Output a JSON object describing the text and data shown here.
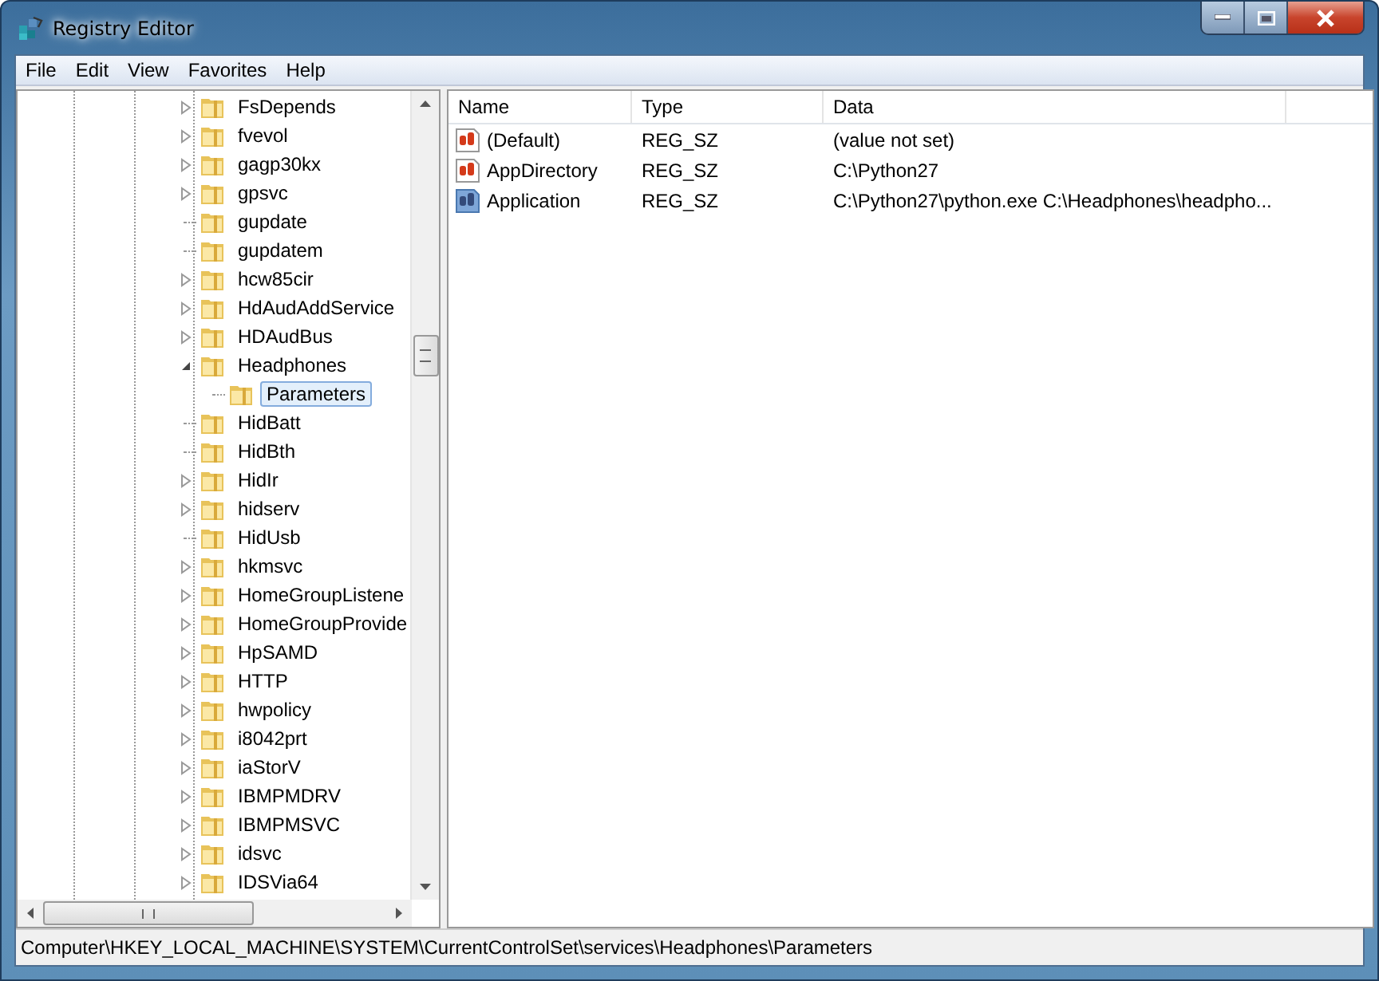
{
  "window": {
    "title": "Registry Editor"
  },
  "menu": [
    "File",
    "Edit",
    "View",
    "Favorites",
    "Help"
  ],
  "tree": [
    {
      "label": "FsDepends",
      "expandable": true,
      "expanded": false,
      "selected": false
    },
    {
      "label": "fvevol",
      "expandable": true,
      "expanded": false,
      "selected": false
    },
    {
      "label": "gagp30kx",
      "expandable": true,
      "expanded": false,
      "selected": false
    },
    {
      "label": "gpsvc",
      "expandable": true,
      "expanded": false,
      "selected": false
    },
    {
      "label": "gupdate",
      "expandable": false,
      "selected": false
    },
    {
      "label": "gupdatem",
      "expandable": false,
      "selected": false
    },
    {
      "label": "hcw85cir",
      "expandable": true,
      "expanded": false,
      "selected": false
    },
    {
      "label": "HdAudAddService",
      "expandable": true,
      "expanded": false,
      "selected": false
    },
    {
      "label": "HDAudBus",
      "expandable": true,
      "expanded": false,
      "selected": false
    },
    {
      "label": "Headphones",
      "expandable": true,
      "expanded": true,
      "selected": false,
      "children": [
        {
          "label": "Parameters",
          "expandable": false,
          "selected": true
        }
      ]
    },
    {
      "label": "HidBatt",
      "expandable": false,
      "selected": false
    },
    {
      "label": "HidBth",
      "expandable": false,
      "selected": false
    },
    {
      "label": "HidIr",
      "expandable": true,
      "expanded": false,
      "selected": false
    },
    {
      "label": "hidserv",
      "expandable": true,
      "expanded": false,
      "selected": false
    },
    {
      "label": "HidUsb",
      "expandable": false,
      "selected": false
    },
    {
      "label": "hkmsvc",
      "expandable": true,
      "expanded": false,
      "selected": false
    },
    {
      "label": "HomeGroupListene",
      "expandable": true,
      "expanded": false,
      "selected": false
    },
    {
      "label": "HomeGroupProvide",
      "expandable": true,
      "expanded": false,
      "selected": false
    },
    {
      "label": "HpSAMD",
      "expandable": true,
      "expanded": false,
      "selected": false
    },
    {
      "label": "HTTP",
      "expandable": true,
      "expanded": false,
      "selected": false
    },
    {
      "label": "hwpolicy",
      "expandable": true,
      "expanded": false,
      "selected": false
    },
    {
      "label": "i8042prt",
      "expandable": true,
      "expanded": false,
      "selected": false
    },
    {
      "label": "iaStorV",
      "expandable": true,
      "expanded": false,
      "selected": false
    },
    {
      "label": "IBMPMDRV",
      "expandable": true,
      "expanded": false,
      "selected": false
    },
    {
      "label": "IBMPMSVC",
      "expandable": true,
      "expanded": false,
      "selected": false
    },
    {
      "label": "idsvc",
      "expandable": true,
      "expanded": false,
      "selected": false
    },
    {
      "label": "IDSVia64",
      "expandable": true,
      "expanded": false,
      "selected": false
    }
  ],
  "table": {
    "columns": [
      "Name",
      "Type",
      "Data"
    ],
    "rows": [
      {
        "name": "(Default)",
        "type": "REG_SZ",
        "data": "(value not set)",
        "selected": false
      },
      {
        "name": "AppDirectory",
        "type": "REG_SZ",
        "data": "C:\\Python27",
        "selected": false
      },
      {
        "name": "Application",
        "type": "REG_SZ",
        "data": "C:\\Python27\\python.exe C:\\Headphones\\headpho...",
        "selected": true
      }
    ]
  },
  "status_bar": "Computer\\HKEY_LOCAL_MACHINE\\SYSTEM\\CurrentControlSet\\services\\Headphones\\Parameters"
}
